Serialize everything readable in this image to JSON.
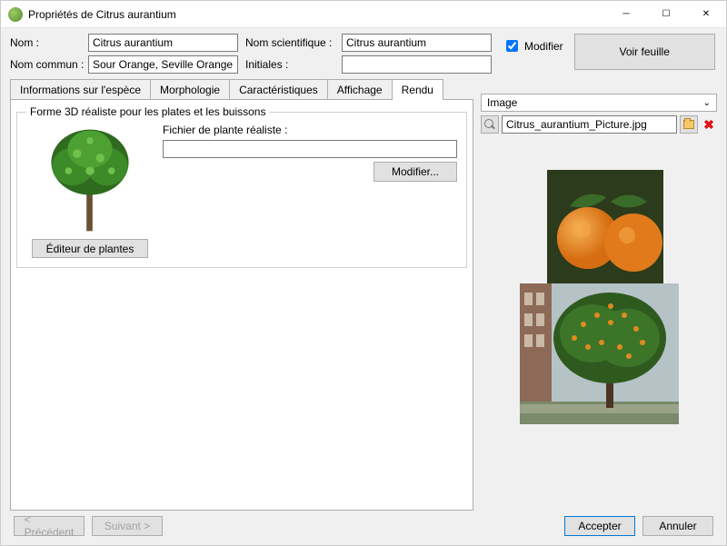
{
  "titlebar": {
    "title": "Propriétés de Citrus aurantium"
  },
  "fields": {
    "name_label": "Nom :",
    "name_value": "Citrus aurantium",
    "common_label": "Nom commun :",
    "common_value": "Sour Orange, Seville Orange",
    "sci_label": "Nom scientifique :",
    "sci_value": "Citrus aurantium",
    "initials_label": "Initiales :",
    "initials_value": ""
  },
  "modifier_checkbox": {
    "label": "Modifier",
    "checked": true
  },
  "voir_feuille": "Voir feuille",
  "tabs": {
    "t0": "Informations sur l'espèce",
    "t1": "Morphologie",
    "t2": "Caractéristiques",
    "t3": "Affichage",
    "t4": "Rendu",
    "active": 4
  },
  "render_group": {
    "legend": "Forme 3D réaliste pour les plates et les buissons",
    "editor_btn": "Éditeur de plantes",
    "file_label": "Fichier de plante réaliste :",
    "file_value": "",
    "modify_btn": "Modifier..."
  },
  "image_panel": {
    "header": "Image",
    "file": "Citrus_aurantium_Picture.jpg"
  },
  "footer": {
    "prev": "< Précédent",
    "next": "Suivant >",
    "accept": "Accepter",
    "cancel": "Annuler"
  }
}
